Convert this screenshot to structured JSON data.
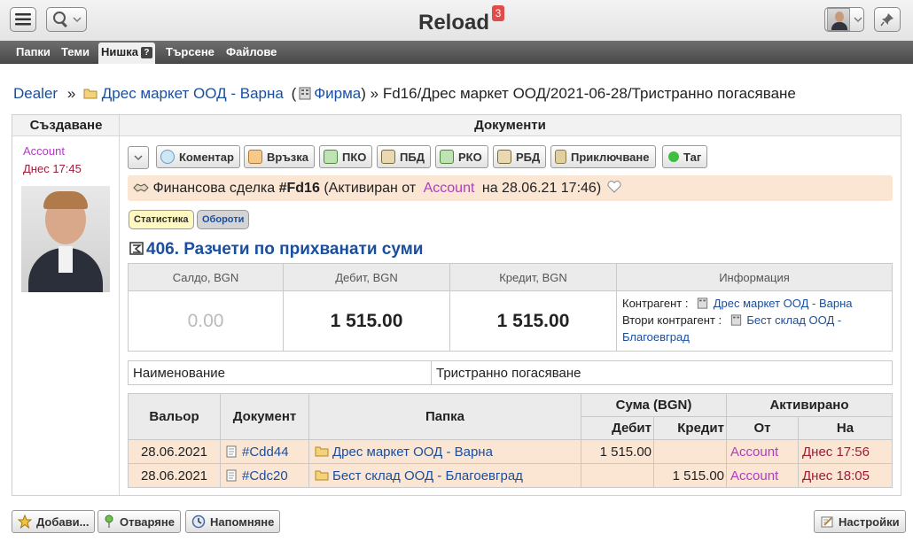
{
  "app": {
    "title": "Reload",
    "notification_count": "3"
  },
  "menu": {
    "items": [
      "Папки",
      "Теми",
      "Нишка",
      "Търсене",
      "Файлове"
    ],
    "help_mark": "?"
  },
  "breadcrumb": {
    "root": "Dealer",
    "sep1": "»",
    "folder": "Дрес маркет ООД - Варна",
    "paren_open": "(",
    "company": "Фирма",
    "rest": ") » Fd16/Дрес маркет ООД/2021-06-28/Тристранно погасяване"
  },
  "columns": {
    "left": "Създаване",
    "right": "Документи"
  },
  "author": {
    "name": "Account",
    "time": "Днес 17:45"
  },
  "toolbar": {
    "buttons": [
      {
        "label": "Коментар",
        "icon": "comment-icon"
      },
      {
        "label": "Връзка",
        "icon": "link-icon"
      },
      {
        "label": "ПКО",
        "icon": "cash-in-icon"
      },
      {
        "label": "ПБД",
        "icon": "bank-in-icon"
      },
      {
        "label": "РКО",
        "icon": "cash-out-icon"
      },
      {
        "label": "РБД",
        "icon": "bank-out-icon"
      },
      {
        "label": "Приключване",
        "icon": "lock-icon"
      },
      {
        "label": "Таг",
        "icon": "tag-dot-icon"
      }
    ]
  },
  "deal": {
    "prefix": "Финансова сделка",
    "number": "#Fd16",
    "status_open": "(Активиран от",
    "by": "Account",
    "date_text": "на 28.06.21 17:46)"
  },
  "tabs": {
    "stats": "Статистика",
    "turnover": "Обороти"
  },
  "section": {
    "title": "406. Разчети по прихванати суми"
  },
  "summary": {
    "headers": [
      "Салдо, BGN",
      "Дебит, BGN",
      "Кредит, BGN",
      "Информация"
    ],
    "saldo": "0.00",
    "debit": "1 515.00",
    "credit": "1 515.00",
    "info": {
      "contragent_label": "Контрагент :",
      "contragent": "Дрес маркет ООД - Варна",
      "second_label": "Втори контрагент :",
      "second_line1": "Бест склад ООД -",
      "second_line2": "Благоевград"
    }
  },
  "name_row": {
    "label": "Наименование",
    "value": "Тристранно погасяване"
  },
  "ledger": {
    "headers": {
      "valor": "Вальор",
      "document": "Документ",
      "folder": "Папка",
      "sum": "Сума (BGN)",
      "debit": "Дебит",
      "credit": "Кредит",
      "activated": "Активирано",
      "from": "От",
      "on": "На"
    },
    "rows": [
      {
        "date": "28.06.2021",
        "doc": "#Cdd44",
        "folder": "Дрес маркет ООД - Варна",
        "debit": "1 515.00",
        "credit": "",
        "from": "Account",
        "on": "Днес 17:56"
      },
      {
        "date": "28.06.2021",
        "doc": "#Cdc20",
        "folder": "Бест склад ООД - Благоевград",
        "debit": "",
        "credit": "1 515.00",
        "from": "Account",
        "on": "Днес 18:05"
      }
    ]
  },
  "footer": {
    "add": "Добави...",
    "open": "Отваряне",
    "remind": "Напомняне",
    "settings": "Настройки"
  },
  "colors": {
    "link": "#1a4fa0",
    "purple": "#b23bc4",
    "maroon": "#a01a3a",
    "deal_bg": "#fbe6d4",
    "menubar": "#555555"
  }
}
